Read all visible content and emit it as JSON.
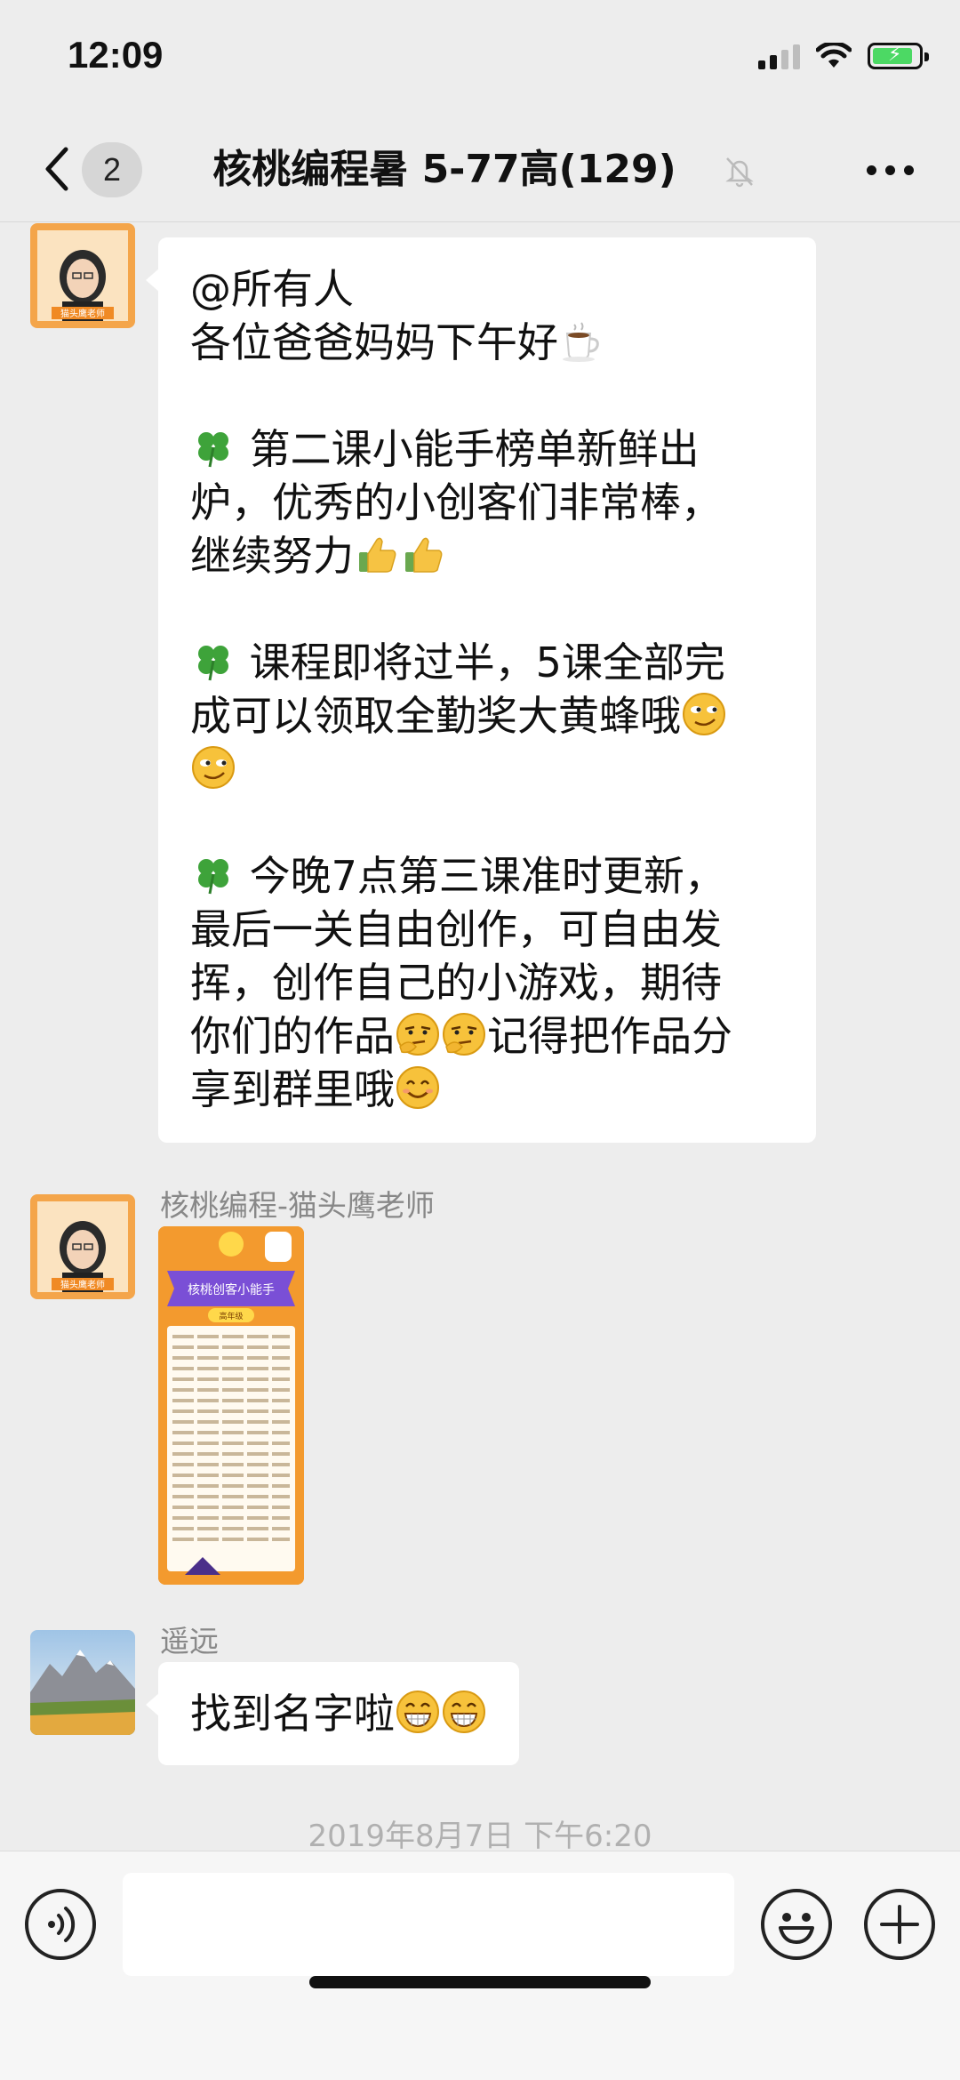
{
  "status_bar": {
    "time": "12:09",
    "battery_level": 0.8
  },
  "nav": {
    "unread_badge": "2",
    "title": "核桃编程暑 5-77高(129)"
  },
  "messages": [
    {
      "sender": "",
      "avatar_label": "猫头鹰老师",
      "lines": {
        "l1": "@所有人",
        "l2": "各位爸爸妈妈下午好",
        "l3": " 第二课小能手榜单新鲜出",
        "l4": "炉，优秀的小创客们非常棒，",
        "l5": "继续努力",
        "l6": " 课程即将过半，5课全部完",
        "l7": "成可以领取全勤奖大黄蜂哦",
        "l8": " 今晚7点第三课准时更新，",
        "l9": "最后一关自由创作，可自由发",
        "l10": "挥，创作自己的小游戏，期待",
        "l11": "你们的作品",
        "l11b": "记得把作品分",
        "l12": "享到群里哦"
      }
    },
    {
      "sender": "核桃编程-猫头鹰老师",
      "avatar_label": "猫头鹰老师",
      "image": {
        "banner": "核桃创客小能手",
        "ribbon": "高年级"
      }
    },
    {
      "sender": "遥远",
      "text": "找到名字啦"
    }
  ],
  "timestamp": "2019年8月7日 下午6:20",
  "icons": {
    "back": "chevron-left-icon",
    "mute": "bell-slash-icon",
    "more": "ellipsis-icon",
    "voice": "voice-icon",
    "emoji": "smiley-icon",
    "add": "plus-icon"
  },
  "colors": {
    "accent_orange": "#f08a24",
    "clover_green": "#3ea33a"
  }
}
